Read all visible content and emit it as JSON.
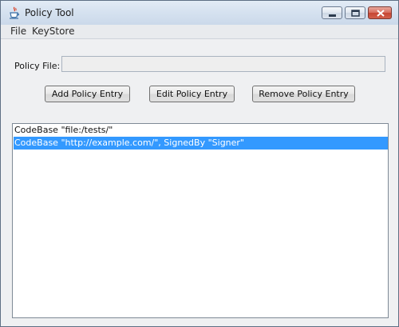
{
  "window": {
    "title": "Policy Tool",
    "icon": "java-icon"
  },
  "menubar": {
    "items": [
      "File",
      "KeyStore"
    ]
  },
  "policy_file": {
    "label": "Policy File:",
    "value": ""
  },
  "buttons": {
    "add": "Add Policy Entry",
    "edit": "Edit Policy Entry",
    "remove": "Remove Policy Entry"
  },
  "entries": [
    {
      "text": "CodeBase \"file:/tests/\"",
      "selected": false
    },
    {
      "text": "CodeBase \"http://example.com/\", SignedBy \"Signer\"",
      "selected": true
    }
  ],
  "colors": {
    "selection": "#3399ff",
    "titlebar": "#d6e2f0",
    "close_button": "#c64633"
  }
}
